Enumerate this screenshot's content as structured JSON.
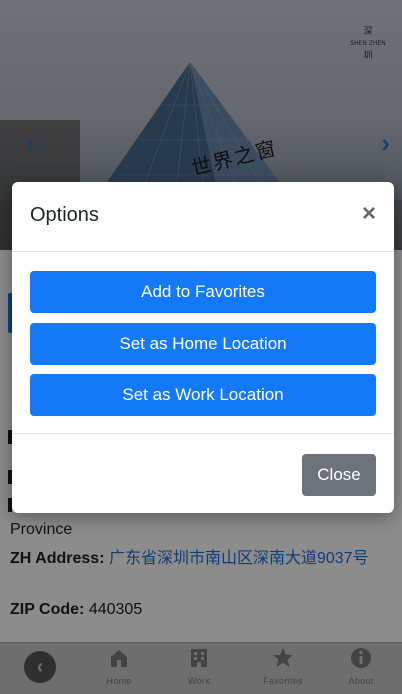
{
  "hero": {
    "sign_text": "世界之窗",
    "logo_top": "深",
    "logo_mid": "SHEN ZHEN",
    "logo_bottom": "圳",
    "arrow_left": "‹",
    "arrow_right": "›"
  },
  "background_info": {
    "province_label": "Province",
    "zh_address_label": "ZH Address:",
    "zh_address_value": "广东省深圳市南山区深南大道9037号",
    "zip_label": "ZIP Code:",
    "zip_value": "440305"
  },
  "modal": {
    "title": "Options",
    "close_x": "×",
    "buttons": [
      {
        "label": "Add to Favorites"
      },
      {
        "label": "Set as Home Location"
      },
      {
        "label": "Set as Work Location"
      }
    ],
    "close_label": "Close"
  },
  "bottom_nav": {
    "back_glyph": "‹",
    "items": [
      {
        "label": "Home",
        "icon": "home-icon"
      },
      {
        "label": "Work",
        "icon": "building-icon"
      },
      {
        "label": "Favorites",
        "icon": "star-icon"
      },
      {
        "label": "About",
        "icon": "info-icon"
      }
    ]
  },
  "colors": {
    "primary_button": "#1479f6",
    "secondary_button": "#6d737a",
    "link": "#1e6fd9"
  }
}
